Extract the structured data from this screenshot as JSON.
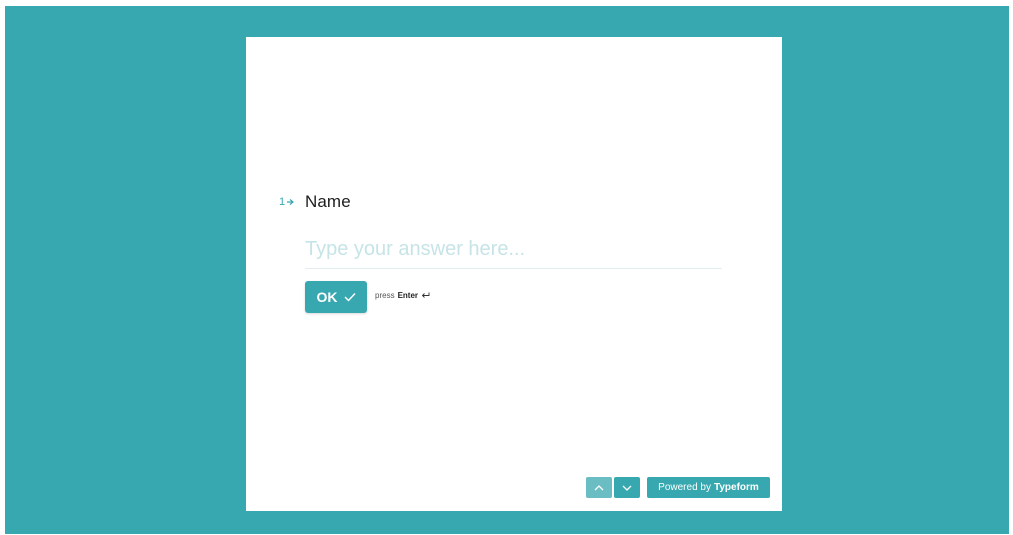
{
  "colors": {
    "accent": "#38a8b0",
    "card": "#ffffff",
    "placeholder": "#c6e4e7"
  },
  "question": {
    "number": "1",
    "arrow_icon": "arrow-right-icon",
    "title": "Name"
  },
  "answer": {
    "value": "",
    "placeholder": "Type your answer here..."
  },
  "ok_button": {
    "label": "OK",
    "icon": "check-icon"
  },
  "hint": {
    "press": "press",
    "key": "Enter",
    "icon": "enter-key-icon"
  },
  "navigation": {
    "up_icon": "chevron-up-icon",
    "down_icon": "chevron-down-icon"
  },
  "powered_by": {
    "prefix": "Powered by",
    "brand": "Typeform"
  }
}
